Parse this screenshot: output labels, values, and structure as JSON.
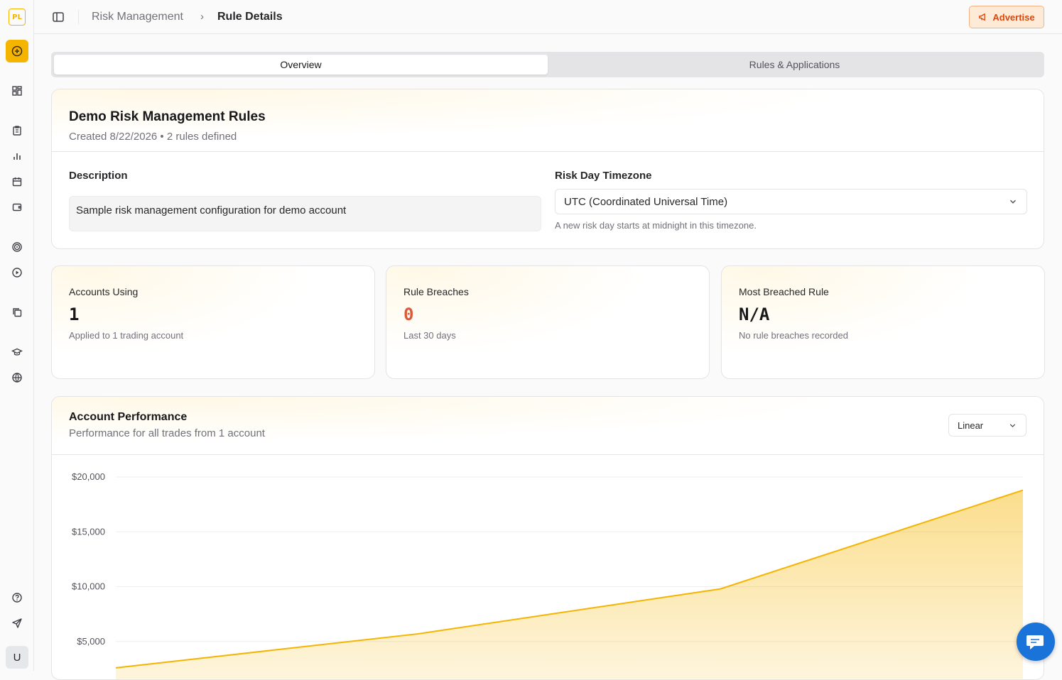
{
  "sidebar": {
    "logo": "PL",
    "user_initial": "U"
  },
  "breadcrumb": {
    "parent": "Risk Management",
    "separator": "›",
    "current": "Rule Details"
  },
  "header": {
    "advertise_label": "Advertise"
  },
  "tabs": [
    {
      "label": "Overview",
      "active": true
    },
    {
      "label": "Rules & Applications",
      "active": false
    }
  ],
  "rule": {
    "title": "Demo Risk Management Rules",
    "meta": "Created 8/22/2026 • 2 rules defined",
    "description_label": "Description",
    "description": "Sample risk management configuration for demo account",
    "timezone_label": "Risk Day Timezone",
    "timezone_value": "UTC (Coordinated Universal Time)",
    "timezone_hint": "A new risk day starts at midnight in this timezone."
  },
  "stats": [
    {
      "label": "Accounts Using",
      "value": "1",
      "sub": "Applied to 1 trading account",
      "color": "#18181b"
    },
    {
      "label": "Rule Breaches",
      "value": "0",
      "sub": "Last 30 days",
      "color": "#dc5a3c"
    },
    {
      "label": "Most Breached Rule",
      "value": "N/A",
      "sub": "No rule breaches recorded",
      "color": "#18181b"
    }
  ],
  "performance": {
    "title": "Account Performance",
    "subtitle": "Performance for all trades from 1 account",
    "scale_value": "Linear"
  },
  "chart_data": {
    "type": "area",
    "y_ticks": [
      "$20,000",
      "$15,000",
      "$10,000",
      "$5,000"
    ],
    "y_tick_values": [
      20000,
      15000,
      10000,
      5000
    ],
    "x": [
      0,
      1,
      2,
      3
    ],
    "values": [
      2600,
      5700,
      9800,
      18800
    ],
    "ylim": [
      0,
      20000
    ],
    "color": "#f5b400",
    "grid": true
  },
  "colors": {
    "accent": "#f5b400",
    "chat": "#1a73d9"
  }
}
